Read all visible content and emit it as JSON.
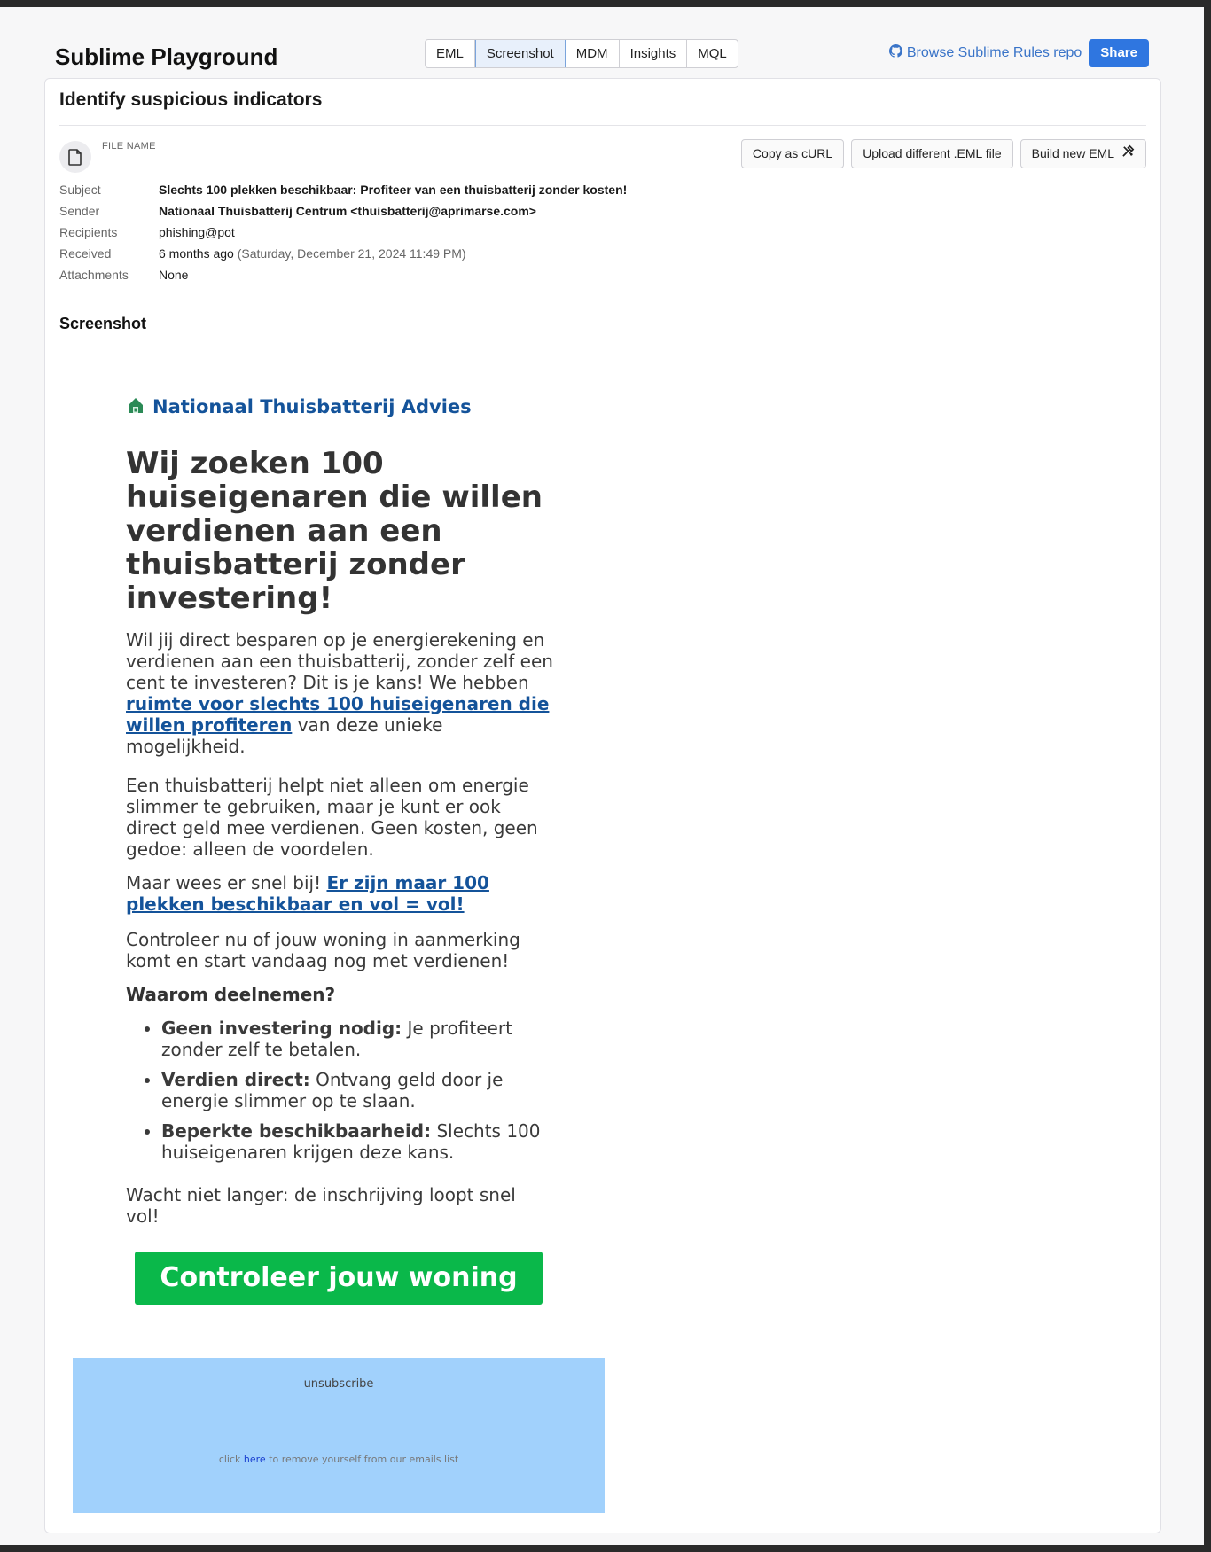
{
  "header": {
    "app_title": "Sublime Playground",
    "tabs": [
      "EML",
      "Screenshot",
      "MDM",
      "Insights",
      "MQL"
    ],
    "active_tab": "Screenshot",
    "repo_link": "Browse Sublime Rules repo",
    "share_label": "Share"
  },
  "card": {
    "title": "Identify suspicious indicators",
    "file_label": "FILE NAME",
    "buttons": {
      "copy_curl": "Copy as cURL",
      "upload": "Upload different .EML file",
      "build": "Build new EML"
    },
    "meta": {
      "subject_label": "Subject",
      "subject": "Slechts 100 plekken beschikbaar: Profiteer van een thuisbatterij zonder kosten!",
      "sender_label": "Sender",
      "sender": "Nationaal Thuisbatterij Centrum <thuisbatterij@aprimarse.com>",
      "recipients_label": "Recipients",
      "recipients": "phishing@pot",
      "received_label": "Received",
      "received_relative": "6 months ago",
      "received_absolute": "(Saturday, December 21, 2024 11:49 PM)",
      "attachments_label": "Attachments",
      "attachments": "None"
    },
    "section_title": "Screenshot"
  },
  "email": {
    "brand": "Nationaal Thuisbatterij Advies",
    "headline": "Wij zoeken 100 huiseigenaren die willen verdienen aan een thuisbatterij zonder investering!",
    "p1_before": "Wil jij direct besparen op je energierekening en verdienen aan een thuisbatterij, zonder zelf een cent te investeren? Dit is je kans! We hebben ",
    "p1_link": "ruimte voor slechts 100 huiseigenaren die willen profiteren",
    "p1_after": " van deze unieke mogelijkheid.",
    "p2": "Een thuisbatterij helpt niet alleen om energie slimmer te gebruiken, maar je kunt er ook direct geld mee verdienen. Geen kosten, geen gedoe: alleen de voordelen.",
    "p3_before": "Maar wees er snel bij! ",
    "p3_link": "Er zijn maar 100 plekken beschikbaar en vol = vol!",
    "p4": "Controleer nu of jouw woning in aanmerking komt en start vandaag nog met verdienen!",
    "why_title": "Waarom deelnemen?",
    "benefits": [
      {
        "title": "Geen investering nodig:",
        "text": " Je profiteert zonder zelf te betalen."
      },
      {
        "title": "Verdien direct:",
        "text": " Ontvang geld door je energie slimmer op te slaan."
      },
      {
        "title": "Beperkte beschikbaarheid:",
        "text": " Slechts 100 huiseigenaren krijgen deze kans."
      }
    ],
    "p5": "Wacht niet langer: de inschrijving loopt snel vol!",
    "cta": "Controleer jouw woning",
    "unsub_title": "unsubscribe",
    "unsub_before": "click ",
    "unsub_link": "here",
    "unsub_after": " to remove yourself from our emails list"
  },
  "colors": {
    "accent": "#2f76e0",
    "brand_blue": "#14539a",
    "cta_green": "#0ab84a",
    "unsub_bg": "#a1d1fc"
  }
}
